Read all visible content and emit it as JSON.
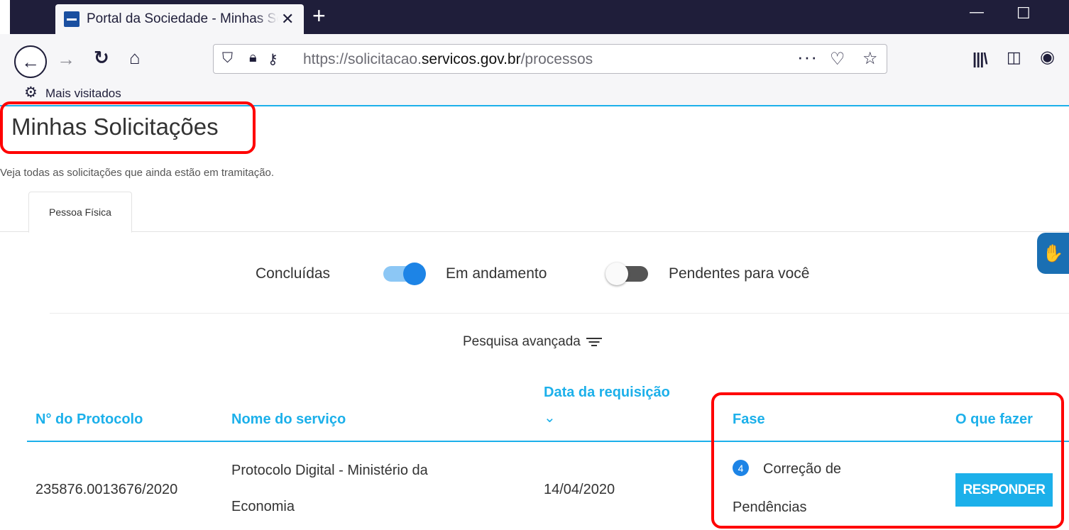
{
  "browser": {
    "tab_title": "Portal da Sociedade - Minhas Solicitações",
    "tab_close": "✕",
    "new_tab": "+",
    "url_host_prefix": "https://solicitacao.",
    "url_host_main": "servicos.gov.br",
    "url_path": "/processos",
    "bookmark_label": "Mais visitados",
    "icons": [
      "back-icon",
      "forward-icon",
      "reload-icon",
      "home-icon",
      "shield-icon",
      "lock-icon",
      "key-icon",
      "more-icon",
      "pocket-icon",
      "star-icon",
      "library-icon",
      "sidebar-icon",
      "account-icon",
      "settings-icon",
      "minimize-icon",
      "maximize-icon"
    ]
  },
  "page": {
    "title": "Minhas Solicitações",
    "subtitle": "Veja todas as solicitações que ainda estão em tramitação.",
    "tab_label": "Pessoa Física"
  },
  "filters": {
    "concluded": "Concluídas",
    "in_progress": "Em andamento",
    "pending": "Pendentes para você",
    "toggle_in_progress_on": true,
    "toggle_pending_on": false,
    "advanced_search": "Pesquisa avançada"
  },
  "table": {
    "headers": {
      "protocol": "N° do Protocolo",
      "service": "Nome do serviço",
      "date": "Data da requisição",
      "phase": "Fase",
      "action": "O que fazer"
    },
    "rows": [
      {
        "protocol": "235876.0013676/2020",
        "service_line1": "Protocolo Digital - Ministério da",
        "service_line2": "Economia",
        "date": "14/04/2020",
        "phase_number": "4",
        "phase_line1": "Correção de",
        "phase_line2": "Pendências",
        "action_label": "RESPONDER"
      }
    ]
  },
  "colors": {
    "accent": "#1cb0ea",
    "toggle_on": "#1d84e6",
    "annotation": "#ff0000",
    "chrome_dark": "#1f1e3a"
  }
}
